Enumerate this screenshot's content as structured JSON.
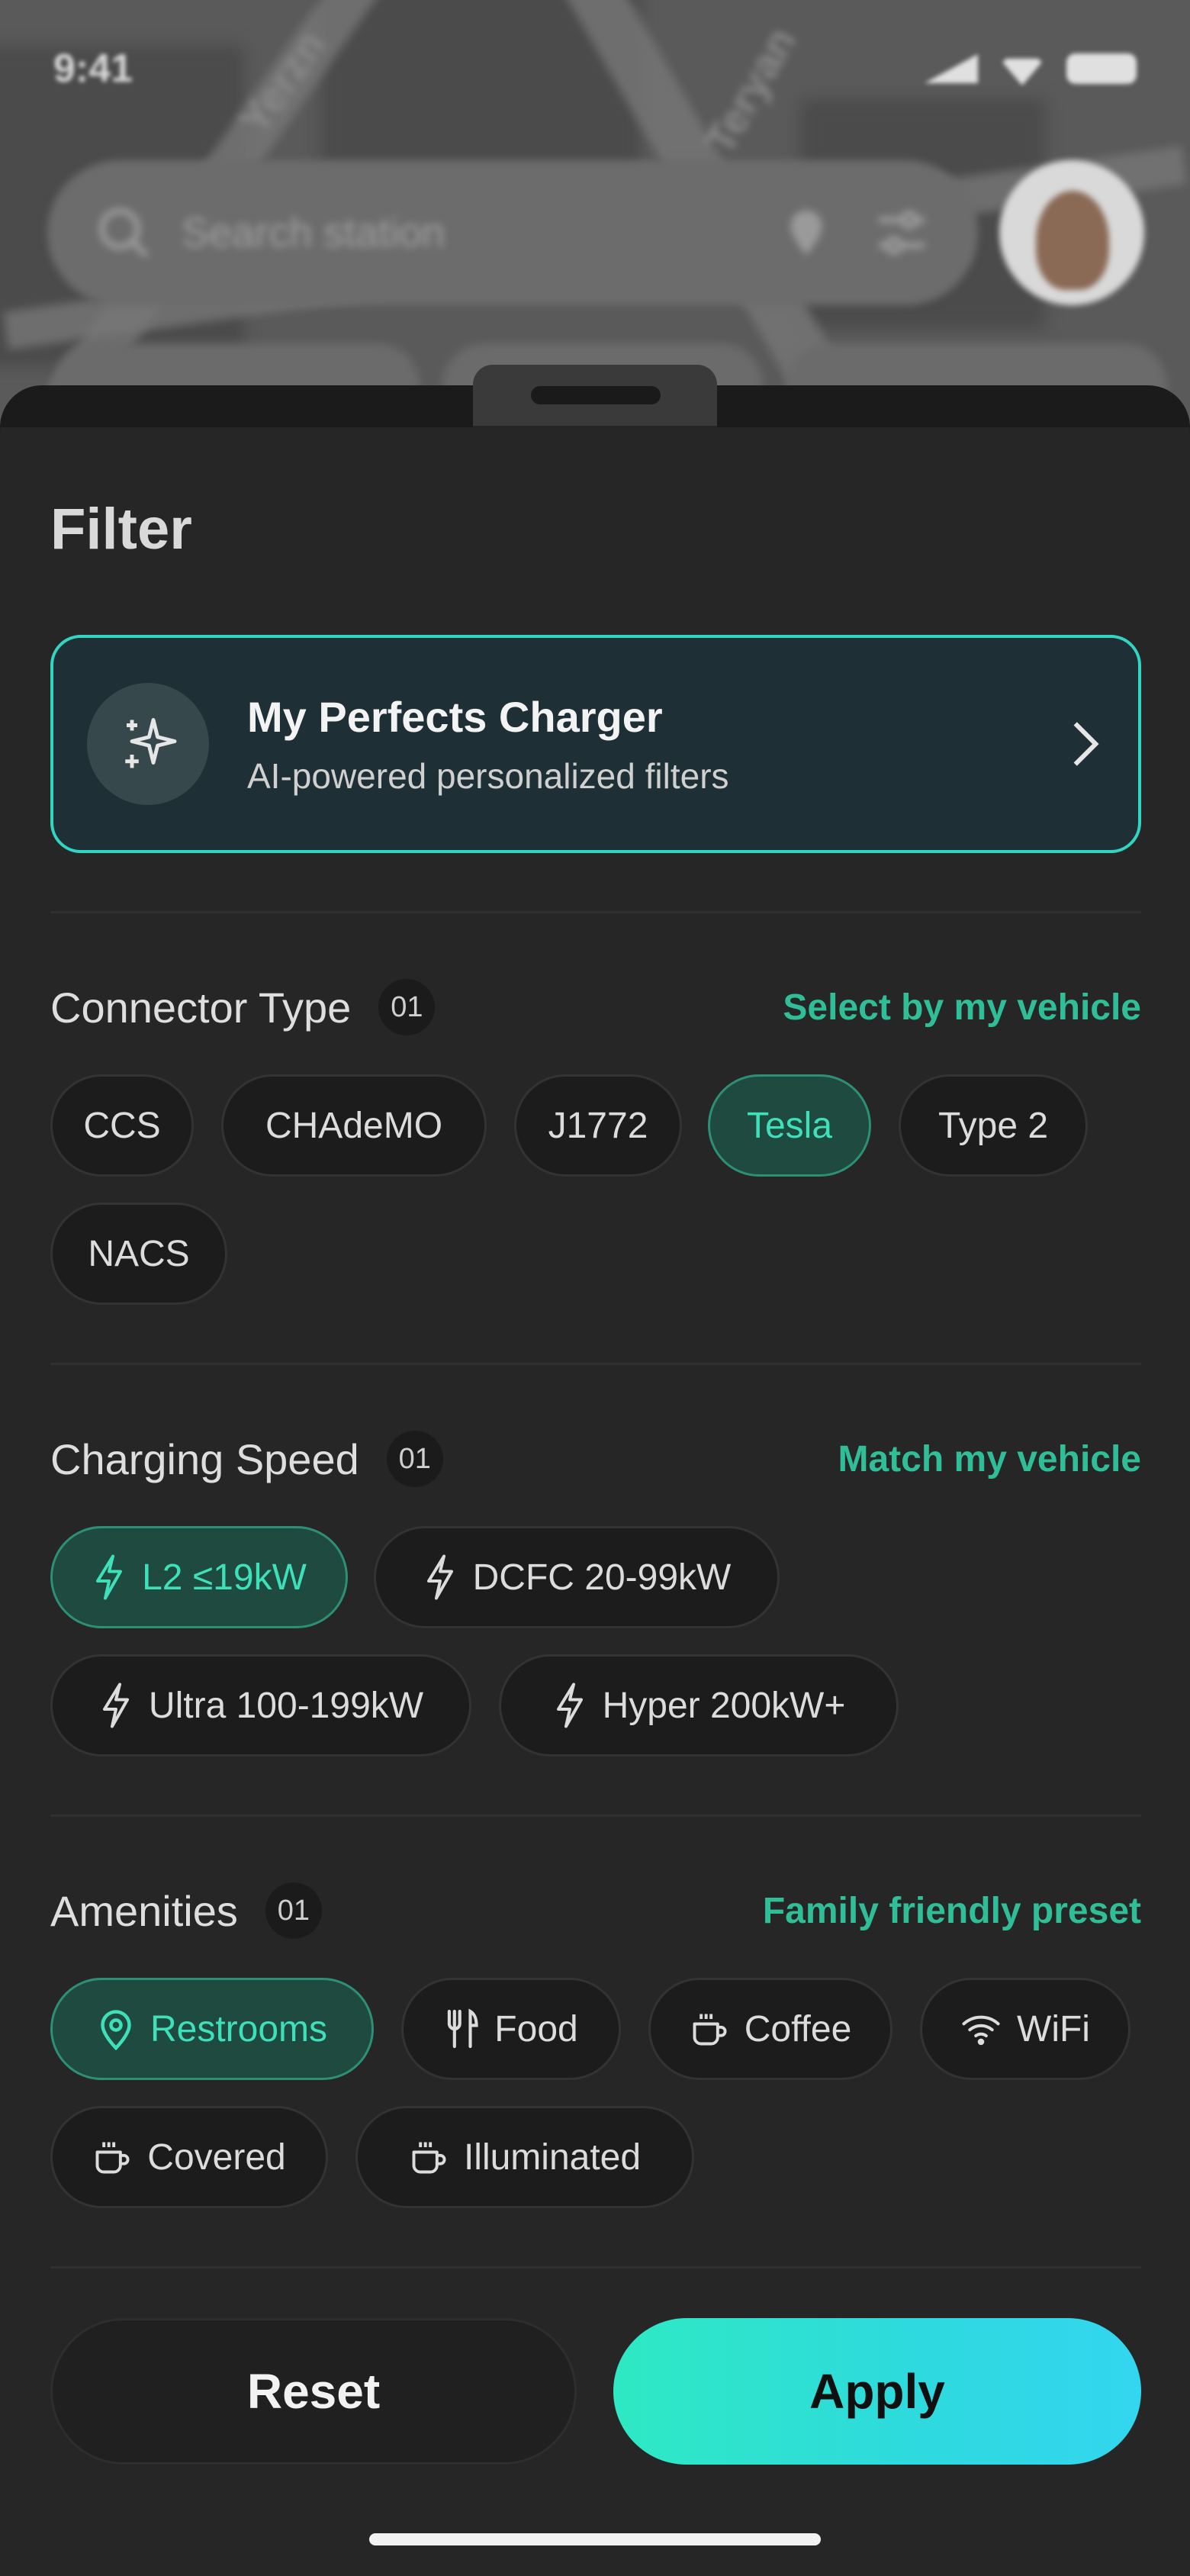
{
  "status_bar": {
    "time": "9:41"
  },
  "search": {
    "placeholder": "Search station"
  },
  "map": {
    "street_labels": [
      "Yerzn",
      "Teryan"
    ]
  },
  "sheet": {
    "title": "Filter"
  },
  "ai_card": {
    "title": "My Perfects Charger",
    "subtitle": "AI-powered personalized filters",
    "icon": "sparkles-icon",
    "accent": "#31d6c2"
  },
  "connector_type": {
    "title": "Connector Type",
    "count": "01",
    "action": "Select by my vehicle",
    "options": [
      {
        "label": "CCS",
        "selected": false
      },
      {
        "label": "CHAdeMO",
        "selected": false
      },
      {
        "label": "J1772",
        "selected": false
      },
      {
        "label": "Tesla",
        "selected": true
      },
      {
        "label": "Type 2",
        "selected": false
      },
      {
        "label": "NACS",
        "selected": false
      }
    ]
  },
  "charging_speed": {
    "title": "Charging Speed",
    "count": "01",
    "action": "Match my vehicle",
    "options": [
      {
        "label": "L2 ≤19kW",
        "icon": "bolt-icon",
        "selected": true
      },
      {
        "label": "DCFC 20-99kW",
        "icon": "bolt-icon",
        "selected": false
      },
      {
        "label": "Ultra 100-199kW",
        "icon": "bolt-icon",
        "selected": false
      },
      {
        "label": "Hyper 200kW+",
        "icon": "bolt-icon",
        "selected": false
      }
    ]
  },
  "amenities": {
    "title": "Amenities",
    "count": "01",
    "action": "Family friendly preset",
    "options": [
      {
        "label": "Restrooms",
        "icon": "location-pin-icon",
        "selected": true
      },
      {
        "label": "Food",
        "icon": "utensils-icon",
        "selected": false
      },
      {
        "label": "Coffee",
        "icon": "coffee-cup-icon",
        "selected": false
      },
      {
        "label": "WiFi",
        "icon": "wifi-icon",
        "selected": false
      },
      {
        "label": "Covered",
        "icon": "coffee-cup-icon",
        "selected": false
      },
      {
        "label": "Illuminated",
        "icon": "coffee-cup-icon",
        "selected": false
      }
    ]
  },
  "buttons": {
    "reset": "Reset",
    "apply": "Apply"
  },
  "colors": {
    "accent_green": "#2fbe98",
    "selected_chip_bg": "#1f4a40",
    "apply_gradient_start": "#2ee9c3",
    "apply_gradient_end": "#33d6ef"
  }
}
